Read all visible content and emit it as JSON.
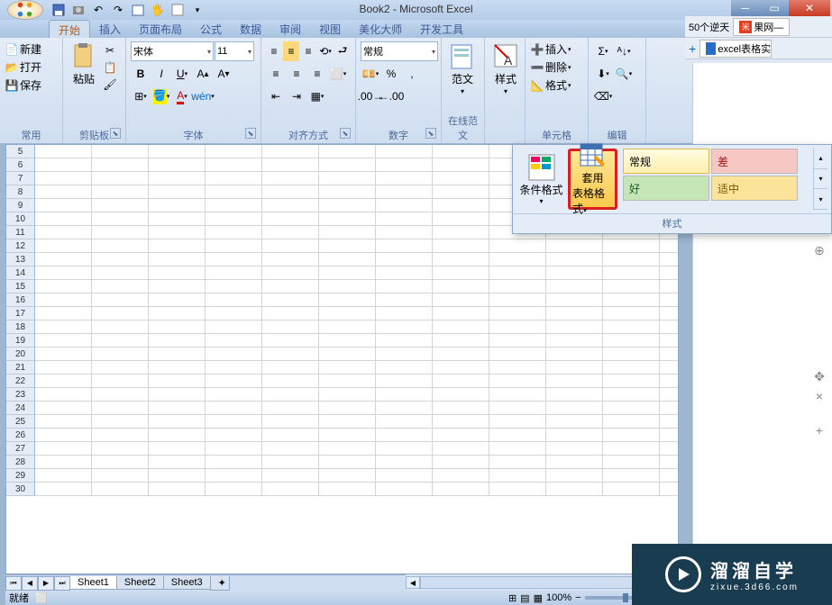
{
  "title": "Book2 - Microsoft Excel",
  "tabs": {
    "items": [
      "开始",
      "插入",
      "页面布局",
      "公式",
      "数据",
      "审阅",
      "视图",
      "美化大师",
      "开发工具"
    ],
    "active_index": 0
  },
  "ribbon": {
    "common": {
      "label": "常用",
      "new": "新建",
      "open": "打开",
      "save": "保存"
    },
    "clipboard": {
      "label": "剪贴板",
      "paste": "粘贴"
    },
    "font": {
      "label": "字体",
      "name": "宋体",
      "size": "11"
    },
    "alignment": {
      "label": "对齐方式"
    },
    "number": {
      "label": "数字",
      "format": "常规"
    },
    "online": {
      "label": "在线范文",
      "btn": "范文"
    },
    "styles": {
      "label": "样式",
      "btn": "样式"
    },
    "cells": {
      "label": "单元格",
      "insert": "插入",
      "delete": "删除",
      "format": "格式"
    },
    "editing": {
      "label": "编辑"
    }
  },
  "styles_popup": {
    "label": "样式",
    "conditional": "条件格式",
    "table": {
      "line1": "套用",
      "line2": "表格格式"
    },
    "normal": "常规",
    "bad": "差",
    "good": "好",
    "neutral": "适中"
  },
  "rows": [
    5,
    6,
    7,
    8,
    9,
    10,
    11,
    12,
    13,
    14,
    15,
    16,
    17,
    18,
    19,
    20,
    21,
    22,
    23,
    24,
    25,
    26,
    27,
    28,
    29,
    30
  ],
  "sheet_tabs": [
    "Sheet1",
    "Sheet2",
    "Sheet3"
  ],
  "status": {
    "ready": "就绪",
    "zoom": "100%"
  },
  "browser": {
    "tab1": "50个逆天",
    "tab2_icon": "米",
    "tab2": "果网—",
    "tab3": "excel表格实用"
  },
  "watermark": {
    "main": "溜溜自学",
    "sub": "zixue.3d66.com"
  }
}
